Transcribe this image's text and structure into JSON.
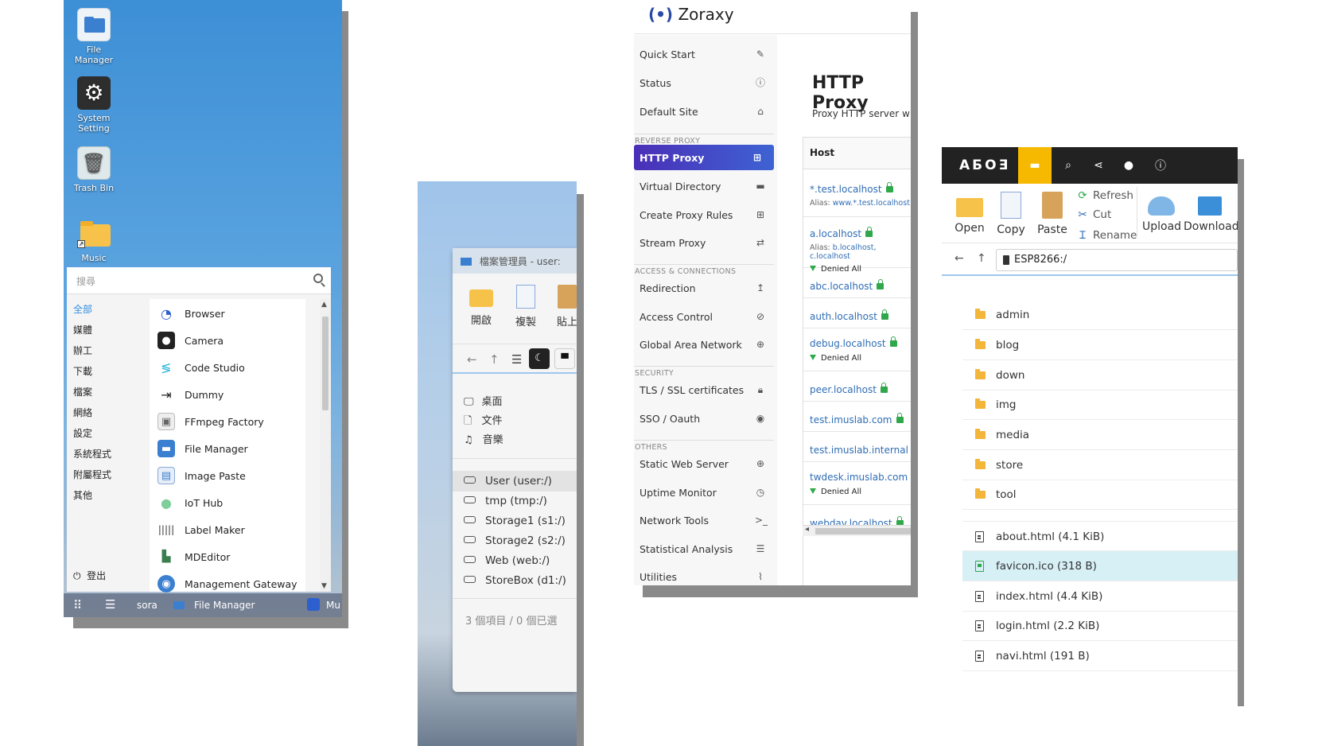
{
  "desktop": {
    "icons": [
      {
        "label": "File Manager"
      },
      {
        "label": "System Setting"
      },
      {
        "label": "Trash Bin"
      },
      {
        "label": "Music"
      }
    ],
    "start_menu": {
      "search_placeholder": "搜尋",
      "categories": [
        "全部",
        "媒體",
        "辦工",
        "下載",
        "檔案",
        "網絡",
        "設定",
        "系統程式",
        "附屬程式",
        "其他"
      ],
      "active_category": "全部",
      "logout_label": "登出",
      "apps": [
        "Browser",
        "Camera",
        "Code Studio",
        "Dummy",
        "FFmpeg Factory",
        "File Manager",
        "Image Paste",
        "IoT Hub",
        "Label Maker",
        "MDEditor",
        "Management Gateway"
      ]
    },
    "taskbar": {
      "user": "sora",
      "window": "File Manager",
      "music": "Mu"
    }
  },
  "filemanager_zh": {
    "title": "檔案管理員 - user:",
    "toolbar": [
      "開啟",
      "複製",
      "貼上"
    ],
    "quick_access": [
      "桌面",
      "文件",
      "音樂"
    ],
    "drives": [
      "User (user:/)",
      "tmp (tmp:/)",
      "Storage1 (s1:/)",
      "Storage2 (s2:/)",
      "Web (web:/)",
      "StoreBox (d1:/)"
    ],
    "selected_drive": "User (user:/)",
    "status": "3 個項目 / 0 個已選"
  },
  "zoraxy": {
    "brand": "Zoraxy",
    "sidebar": {
      "top": [
        {
          "label": "Quick Start",
          "icon": "magic-wand-icon"
        },
        {
          "label": "Status",
          "icon": "info-icon"
        },
        {
          "label": "Default Site",
          "icon": "home-icon"
        }
      ],
      "sections": [
        {
          "title": "REVERSE PROXY",
          "items": [
            {
              "label": "HTTP Proxy",
              "icon": "sitemap-icon",
              "active": true
            },
            {
              "label": "Virtual Directory",
              "icon": "folder-icon"
            },
            {
              "label": "Create Proxy Rules",
              "icon": "plus-square-icon"
            },
            {
              "label": "Stream Proxy",
              "icon": "exchange-icon"
            }
          ]
        },
        {
          "title": "ACCESS & CONNECTIONS",
          "items": [
            {
              "label": "Redirection",
              "icon": "arrow-up-icon"
            },
            {
              "label": "Access Control",
              "icon": "ban-icon"
            },
            {
              "label": "Global Area Network",
              "icon": "globe-icon"
            }
          ]
        },
        {
          "title": "SECURITY",
          "items": [
            {
              "label": "TLS / SSL certificates",
              "icon": "lock-icon"
            },
            {
              "label": "SSO / Oauth",
              "icon": "user-circle-icon"
            }
          ]
        },
        {
          "title": "OTHERS",
          "items": [
            {
              "label": "Static Web Server",
              "icon": "globe-icon"
            },
            {
              "label": "Uptime Monitor",
              "icon": "clock-icon"
            },
            {
              "label": "Network Tools",
              "icon": "terminal-icon"
            },
            {
              "label": "Statistical Analysis",
              "icon": "database-icon"
            },
            {
              "label": "Utilities",
              "icon": "paperclip-icon"
            }
          ]
        }
      ]
    },
    "main": {
      "title": "HTTP Proxy",
      "subtitle": "Proxy HTTP server with",
      "table_header": "Host",
      "rows": [
        {
          "host": "*.test.localhost",
          "alias_label": "Alias:",
          "alias": "www.*.test.localhost"
        },
        {
          "host": "a.localhost",
          "alias_label": "Alias:",
          "alias": "b.localhost, c.localhost",
          "deny": "Denied All"
        },
        {
          "host": "abc.localhost"
        },
        {
          "host": "auth.localhost"
        },
        {
          "host": "debug.localhost",
          "deny": "Denied All"
        },
        {
          "host": "peer.localhost"
        },
        {
          "host": "test.imuslab.com"
        },
        {
          "host": "test.imuslab.internal"
        },
        {
          "host": "twdesk.imuslab.com",
          "deny": "Denied All"
        },
        {
          "host": "webdav.localhost"
        }
      ]
    }
  },
  "esp_fm": {
    "logo": "AƂOƎ",
    "toolbar": {
      "open": "Open",
      "copy": "Copy",
      "paste": "Paste",
      "refresh": "Refresh",
      "cut": "Cut",
      "rename": "Rename",
      "upload": "Upload",
      "download": "Download"
    },
    "path": "ESP8266:/",
    "folders": [
      "admin",
      "blog",
      "down",
      "img",
      "media",
      "store",
      "tool"
    ],
    "files": [
      {
        "name": "about.html (4.1 KiB)",
        "kind": "doc"
      },
      {
        "name": "favicon.ico (318 B)",
        "kind": "image",
        "selected": true
      },
      {
        "name": "index.html (4.4 KiB)",
        "kind": "doc"
      },
      {
        "name": "login.html (2.2 KiB)",
        "kind": "doc"
      },
      {
        "name": "navi.html (191 B)",
        "kind": "doc"
      }
    ]
  }
}
